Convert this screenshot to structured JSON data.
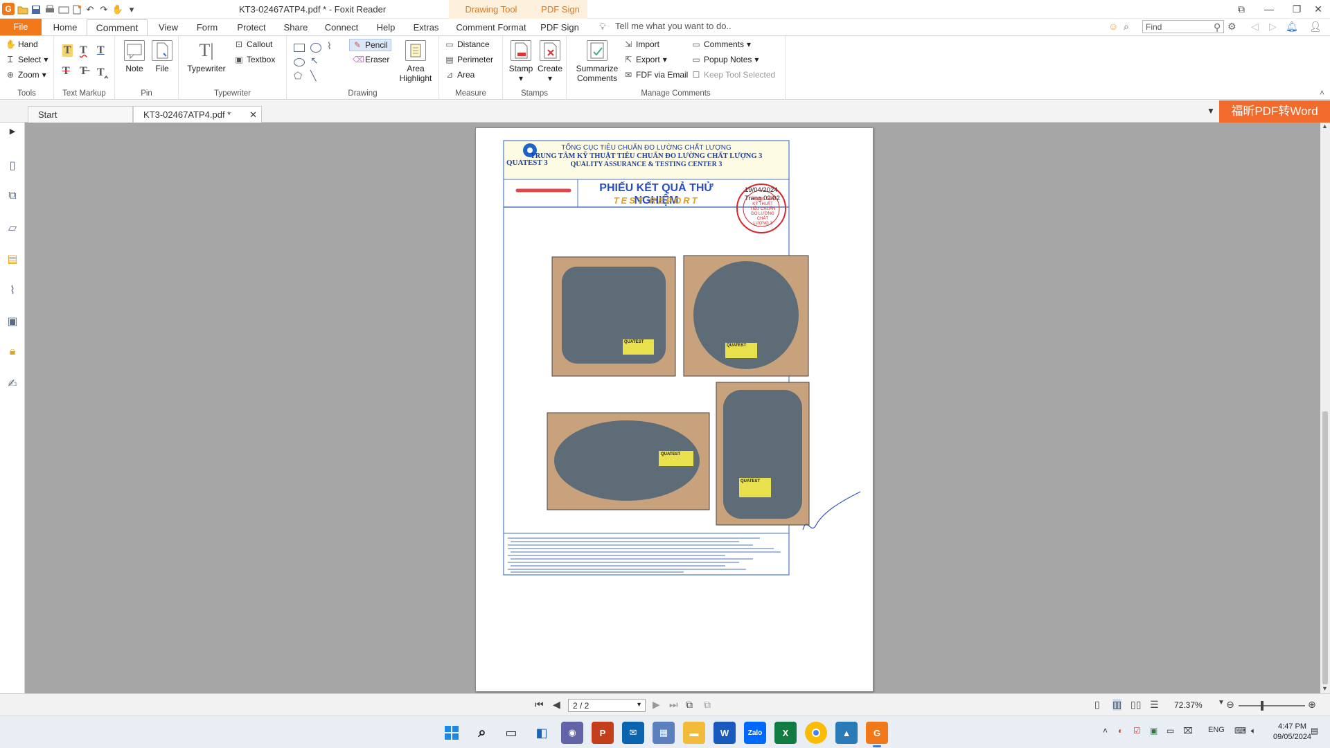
{
  "app": {
    "window_title": "KT3-02467ATP4.pdf * - Foxit Reader",
    "context_tabs": [
      "Drawing Tool",
      "PDF Sign"
    ]
  },
  "ribbon_tabs": [
    "File",
    "Home",
    "Comment",
    "View",
    "Form",
    "Protect",
    "Share",
    "Connect",
    "Help",
    "Extras",
    "Comment Format",
    "PDF Sign"
  ],
  "active_tab": "Comment",
  "tell_me": "Tell me what you want to do..",
  "find": {
    "placeholder": "Find"
  },
  "groups": {
    "tools": {
      "label": "Tools",
      "hand": "Hand",
      "select": "Select",
      "zoom": "Zoom"
    },
    "text_markup": {
      "label": "Text Markup"
    },
    "pin": {
      "label": "Pin",
      "note": "Note",
      "file": "File"
    },
    "typewriter": {
      "label": "Typewriter",
      "typewriter": "Typewriter",
      "callout": "Callout",
      "textbox": "Textbox"
    },
    "drawing": {
      "label": "Drawing",
      "pencil": "Pencil",
      "eraser": "Eraser",
      "area_highlight_1": "Area",
      "area_highlight_2": "Highlight"
    },
    "measure": {
      "label": "Measure",
      "distance": "Distance",
      "perimeter": "Perimeter",
      "area": "Area"
    },
    "stamps": {
      "label": "Stamps",
      "stamp": "Stamp",
      "create": "Create"
    },
    "manage": {
      "label": "Manage Comments",
      "summarize_1": "Summarize",
      "summarize_2": "Comments",
      "import": "Import",
      "export": "Export",
      "fdf": "FDF via Email",
      "comments": "Comments",
      "popup": "Popup Notes",
      "keep": "Keep Tool Selected"
    }
  },
  "doc_tabs": [
    "Start",
    "KT3-02467ATP4.pdf *"
  ],
  "promo": "福昕PDF转Word",
  "document": {
    "org_line1": "TỔNG CỤC TIÊU CHUẨN ĐO LƯỜNG CHẤT LƯỢNG",
    "org_line2": "TRUNG TÂM KỸ THUẬT TIÊU CHUẨN ĐO LƯỜNG CHẤT LƯỢNG 3",
    "org_line3": "QUALITY ASSURANCE & TESTING CENTER 3",
    "logo_text": "QUATEST 3",
    "report_title_vn": "PHIẾU KẾT QUẢ THỬ NGHIỆM",
    "report_title_en": "TEST REPORT",
    "date": "19/04/2024",
    "page_label": "Trang 02/02",
    "seal_text": "TRUNG TÂM KỸ THUẬT TIÊU CHUẨN ĐO LƯỜNG CHẤT LƯỢNG 3",
    "photo_label": "QUATEST"
  },
  "status": {
    "page": "2 / 2",
    "zoom": "72.37%"
  },
  "taskbar": {
    "time": "4:47 PM",
    "date": "09/05/2024",
    "lang": "ENG"
  },
  "colors": {
    "accent": "#f07818",
    "doc_blue": "#1a3fa6",
    "seal_red": "#d8262c"
  }
}
